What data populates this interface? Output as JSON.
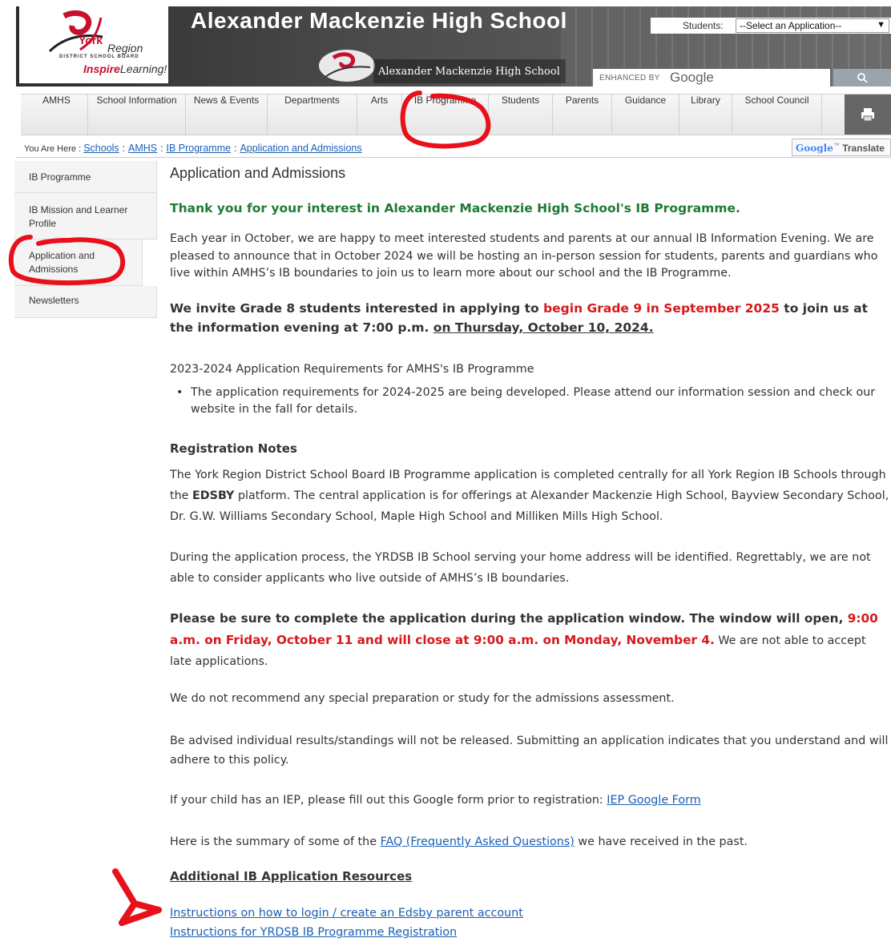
{
  "header": {
    "site_title": "Alexander Mackenzie High School",
    "sub_title": "Alexander Mackenzie High School",
    "logo": {
      "york": "York",
      "region": "Region",
      "district": "DISTRICT SCHOOL BOARD",
      "inspire_bold": "Inspire",
      "inspire_rest": "Learning!"
    },
    "students_label": "Students:",
    "students_select": "--Select an Application--",
    "search_enhanced": "ENHANCED BY",
    "search_google": "Google"
  },
  "nav": {
    "items": [
      "AMHS",
      "School Information",
      "News & Events",
      "Departments",
      "Arts",
      "IB Programme",
      "Students",
      "Parents",
      "Guidance",
      "Library",
      "School Council"
    ]
  },
  "breadcrumb": {
    "prefix": "You Are Here :",
    "items": [
      "Schools",
      "AMHS",
      "IB Programme",
      "Application and Admissions"
    ],
    "sep": ":"
  },
  "translate": {
    "google": "Google",
    "tm": "™",
    "label": "Translate"
  },
  "sidebar": {
    "items": [
      "IB Programme",
      "IB Mission and Learner Profile",
      "Application and Admissions",
      "Newsletters"
    ]
  },
  "content": {
    "title": "Application and Admissions",
    "thanks": "Thank you for your interest in Alexander Mackenzie High School's IB Programme.",
    "p1": "Each year in October, we are happy to meet interested students and parents at our annual IB Information Evening. We are pleased to announce that in October 2024 we will be hosting an in-person session for students, parents and guardians who live within AMHS’s IB boundaries to join us to learn more about our school and the IB Programme.",
    "invite_a": "We invite Grade 8 students interested in applying to ",
    "invite_red": "begin Grade 9 in September 2025",
    "invite_b": " to join us at the information evening at 7:00 p.m. ",
    "invite_ul": "on Thursday, October 10, 2024.",
    "req_title": "2023-2024 Application Requirements for AMHS's IB Programme",
    "req_bullet": "The application requirements for 2024-2025 are being developed. Please attend our information session and check our website in the fall for details.",
    "reg_heading": "Registration Notes",
    "reg_a": "The York Region District School Board IB Programme application is completed centrally for all York Region IB Schools through the ",
    "reg_bold": "EDSBY",
    "reg_b": " platform. The central application is for offerings at  Alexander Mackenzie High School, Bayview Secondary School, Dr. G.W. Williams Secondary  School, Maple High School and Milliken Mills High School.",
    "process": "During the application process, the YRDSB IB School serving your home address will be identified. Regrettably, we are not able to consider applicants who live outside of AMHS’s IB boundaries.",
    "window_a": "Please be sure to complete the application during the application window. The window will open, ",
    "window_red": "9:00 a.m. on Friday, October 11 and will close at 9:00 a.m. on Monday, November 4.",
    "window_b": "  We are not able to accept late applications.",
    "no_prep": "We do not recommend any special preparation or study for the admissions assessment.",
    "advised": "Be advised individual results/standings will not be released. Submitting an application indicates that you understand and will adhere to this policy.",
    "iep_a": "If your child has an IEP, please fill out this Google form prior to registration: ",
    "iep_link": "IEP Google Form",
    "faq_a": "Here is the summary of some of the ",
    "faq_link": "FAQ (Frequently Asked Questions)",
    "faq_b": " we have received in the past.",
    "resources_heading": "Additional IB Application Resources",
    "link1": "Instructions on how to login / create an Edsby parent account",
    "link2": "Instructions for YRDSB IB Programme Registration"
  },
  "colors": {
    "green": "#1e7b34",
    "red": "#d7191c",
    "link": "#1a5fb4",
    "annotation": "#e8101a"
  }
}
